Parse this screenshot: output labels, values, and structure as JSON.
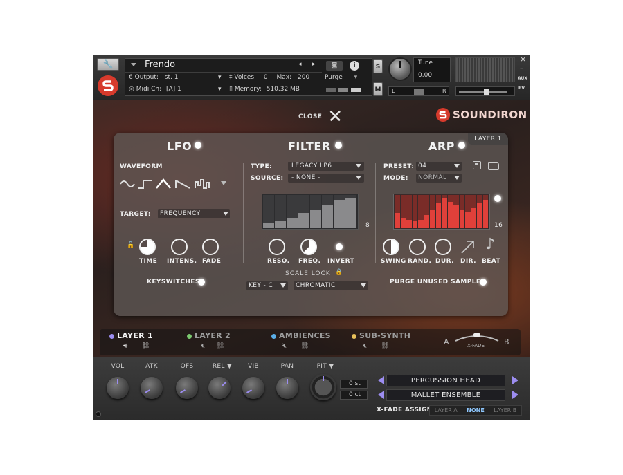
{
  "kontakt": {
    "instrument_name": "Frendo",
    "output_label": "Output:",
    "output_value": "st. 1",
    "midi_label": "Midi Ch:",
    "midi_value": "[A]  1",
    "voices_label": "Voices:",
    "voices_value": "0",
    "max_label": "Max:",
    "max_value": "200",
    "memory_label": "Memory:",
    "memory_value": "510.32 MB",
    "purge_label": "Purge",
    "solo_label": "S",
    "mute_label": "M",
    "tune_label": "Tune",
    "tune_value": "0.00",
    "pan_left": "L",
    "pan_right": "R",
    "aux_label": "AUX",
    "pv_label": "PV",
    "close_glyph": "×",
    "min_glyph": "–"
  },
  "branding": {
    "logo_text": "SOUNDIRON",
    "close_label": "CLOSE"
  },
  "lfo": {
    "title": "LFO",
    "waveform_label": "WAVEFORM",
    "waveforms": [
      "sine-wave-icon",
      "square-wave-icon",
      "triangle-wave-icon",
      "saw-wave-icon",
      "random-wave-icon"
    ],
    "selected_waveform": 2,
    "target_label": "TARGET:",
    "target_value": "FREQUENCY",
    "knobs": [
      "TIME",
      "INTENS.",
      "FADE"
    ],
    "keyswitches_label": "KEYSWITCHES"
  },
  "filter": {
    "title": "FILTER",
    "type_label": "TYPE:",
    "type_value": "LEGACY LP6",
    "source_label": "SOURCE:",
    "source_value": "- NONE -",
    "steps_count": "8",
    "step_levels": [
      0.15,
      0.2,
      0.3,
      0.45,
      0.55,
      0.7,
      0.85,
      0.9
    ],
    "knobs": [
      "RESO.",
      "FREQ.",
      "INVERT"
    ],
    "scale_lock_label": "SCALE LOCK",
    "key_value": "KEY - C",
    "scale_value": "CHROMATIC"
  },
  "arp": {
    "title": "ARP",
    "layer_badge": "LAYER 1",
    "preset_label": "PRESET:",
    "preset_value": "04",
    "mode_label": "MODE:",
    "mode_value": "NORMAL",
    "steps_count": "16",
    "step_levels": [
      0.45,
      0.3,
      0.25,
      0.2,
      0.25,
      0.4,
      0.55,
      0.75,
      0.9,
      0.8,
      0.7,
      0.55,
      0.5,
      0.6,
      0.75,
      0.85
    ],
    "knobs": [
      "SWING",
      "RAND.",
      "DUR.",
      "DIR.",
      "BEAT"
    ],
    "purge_label": "PURGE UNUSED SAMPLES"
  },
  "layers": [
    {
      "name": "LAYER 1",
      "color": "#9c8df0",
      "active": true
    },
    {
      "name": "LAYER 2",
      "color": "#7bc96f",
      "active": false
    },
    {
      "name": "AMBIENCES",
      "color": "#5aaee8",
      "active": false
    },
    {
      "name": "SUB-SYNTH",
      "color": "#e8c05a",
      "active": false
    }
  ],
  "xfade": {
    "a_label": "A",
    "b_label": "B",
    "label": "X-FADE",
    "assign_label": "X-FADE ASSIGN",
    "options": [
      "LAYER A",
      "NONE",
      "LAYER B"
    ],
    "selected": 1
  },
  "bottom": {
    "knobs": [
      "VOL",
      "ATK",
      "OFS",
      "REL",
      "VIB",
      "PAN",
      "PIT"
    ],
    "pitch_st": "0 st",
    "pitch_ct": "0 ct",
    "patch_1": "PERCUSSION HEAD",
    "patch_2": "MALLET ENSEMBLE"
  },
  "colors": {
    "accent": "#9c8df0",
    "arp_red": "#e0403a",
    "brand_red": "#d63a2c"
  }
}
